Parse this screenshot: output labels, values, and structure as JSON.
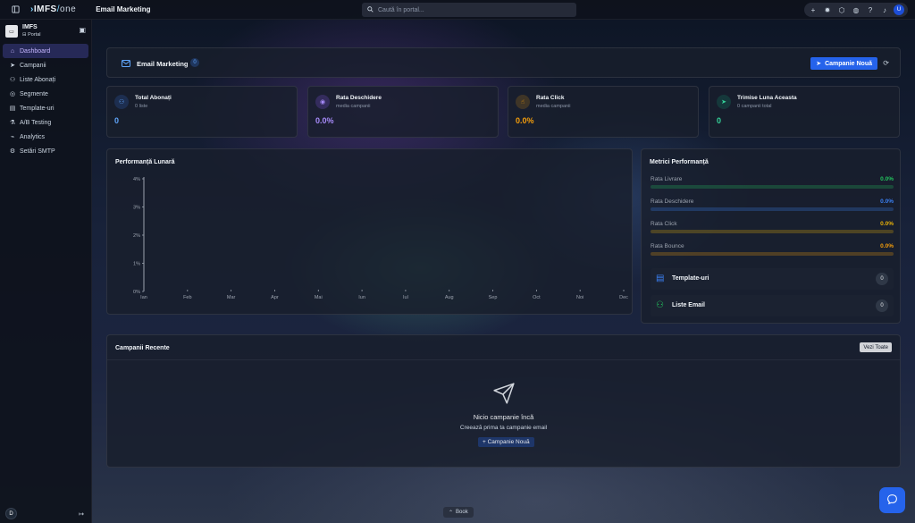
{
  "topbar": {
    "brand_main": "IMFS",
    "brand_slash": "/",
    "brand_suffix": "one",
    "page_title": "Email Marketing",
    "search_placeholder": "Caută în portal...",
    "avatar_initial": "U"
  },
  "sidebar": {
    "org_name": "IMFS",
    "org_sub": "Portal",
    "items": [
      {
        "label": "Dashboard",
        "icon": "home-icon",
        "active": true
      },
      {
        "label": "Campanii",
        "icon": "send-icon"
      },
      {
        "label": "Liste Abonați",
        "icon": "users-icon"
      },
      {
        "label": "Segmente",
        "icon": "segments-icon"
      },
      {
        "label": "Template-uri",
        "icon": "template-icon"
      },
      {
        "label": "A/B Testing",
        "icon": "ab-test-icon"
      },
      {
        "label": "Analytics",
        "icon": "analytics-icon"
      },
      {
        "label": "Setări SMTP",
        "icon": "settings-icon"
      }
    ],
    "user_initial": "D"
  },
  "header": {
    "title": "Email Marketing",
    "badge": "0",
    "new_button": "Campanie Nouă"
  },
  "stats": [
    {
      "title": "Total Abonați",
      "sub": "0 liste",
      "value": "0",
      "color": "#60a5fa",
      "icon": "users-icon"
    },
    {
      "title": "Rata Deschidere",
      "sub": "media campanii",
      "value": "0.0%",
      "color": "#a78bfa",
      "icon": "eye-icon"
    },
    {
      "title": "Rata Click",
      "sub": "media campanii",
      "value": "0.0%",
      "color": "#f59e0b",
      "icon": "pointer-icon"
    },
    {
      "title": "Trimise Luna Aceasta",
      "sub": "0 campanii total",
      "value": "0",
      "color": "#34d399",
      "icon": "send-icon"
    }
  ],
  "chart_data": {
    "type": "line",
    "title": "Performanță Lunară",
    "categories": [
      "Ian",
      "Feb",
      "Mar",
      "Apr",
      "Mai",
      "Iun",
      "Iul",
      "Aug",
      "Sep",
      "Oct",
      "Noi",
      "Dec"
    ],
    "series": [],
    "yticks": [
      "4%",
      "3%",
      "2%",
      "1%",
      "0%"
    ],
    "ylim": [
      0,
      4
    ],
    "grid": false
  },
  "metrics": {
    "title": "Metrici Performanță",
    "rows": [
      {
        "label": "Rata Livrare",
        "value": "0.0%",
        "fraction": 0,
        "color": "#22c55e"
      },
      {
        "label": "Rata Deschidere",
        "value": "0.0%",
        "fraction": 0,
        "color": "#3b82f6"
      },
      {
        "label": "Rata Click",
        "value": "0.0%",
        "fraction": 0,
        "color": "#eab308"
      },
      {
        "label": "Rata Bounce",
        "value": "0.0%",
        "fraction": 0,
        "color": "#f59e0b"
      }
    ],
    "cards": [
      {
        "label": "Template-uri",
        "count": "0",
        "color": "#3b82f6",
        "icon": "template-icon"
      },
      {
        "label": "Liste Email",
        "count": "0",
        "color": "#22c55e",
        "icon": "users-icon"
      }
    ]
  },
  "recent": {
    "title": "Campanii Recente",
    "see_all": "Vezi Toate",
    "empty_title": "Nicio campanie încă",
    "empty_sub": "Creează prima ta campanie email",
    "empty_button": "+ Campanie Nouă"
  },
  "book_label": "Book"
}
